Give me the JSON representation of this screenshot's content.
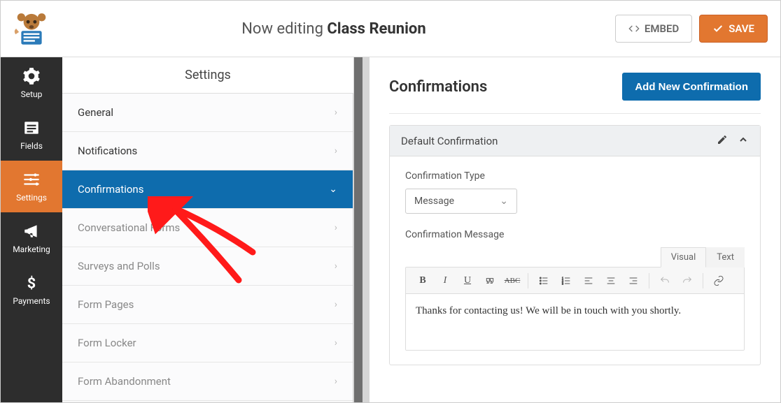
{
  "header": {
    "now_editing": "Now editing",
    "form_name": "Class Reunion",
    "embed": "EMBED",
    "save": "SAVE"
  },
  "sidebar": {
    "items": [
      {
        "id": "setup",
        "label": "Setup"
      },
      {
        "id": "fields",
        "label": "Fields"
      },
      {
        "id": "settings",
        "label": "Settings"
      },
      {
        "id": "marketing",
        "label": "Marketing"
      },
      {
        "id": "payments",
        "label": "Payments"
      }
    ],
    "active": "settings"
  },
  "settings_panel": {
    "title": "Settings",
    "items": [
      {
        "label": "General"
      },
      {
        "label": "Notifications"
      },
      {
        "label": "Confirmations",
        "active": true
      },
      {
        "label": "Conversational Forms"
      },
      {
        "label": "Surveys and Polls"
      },
      {
        "label": "Form Pages"
      },
      {
        "label": "Form Locker"
      },
      {
        "label": "Form Abandonment"
      }
    ]
  },
  "main": {
    "heading": "Confirmations",
    "add_button": "Add New Confirmation",
    "panel_title": "Default Confirmation",
    "type_label": "Confirmation Type",
    "type_value": "Message",
    "message_label": "Confirmation Message",
    "tabs": {
      "visual": "Visual",
      "text": "Text"
    },
    "message_content": "Thanks for contacting us! We will be in touch with you shortly."
  }
}
